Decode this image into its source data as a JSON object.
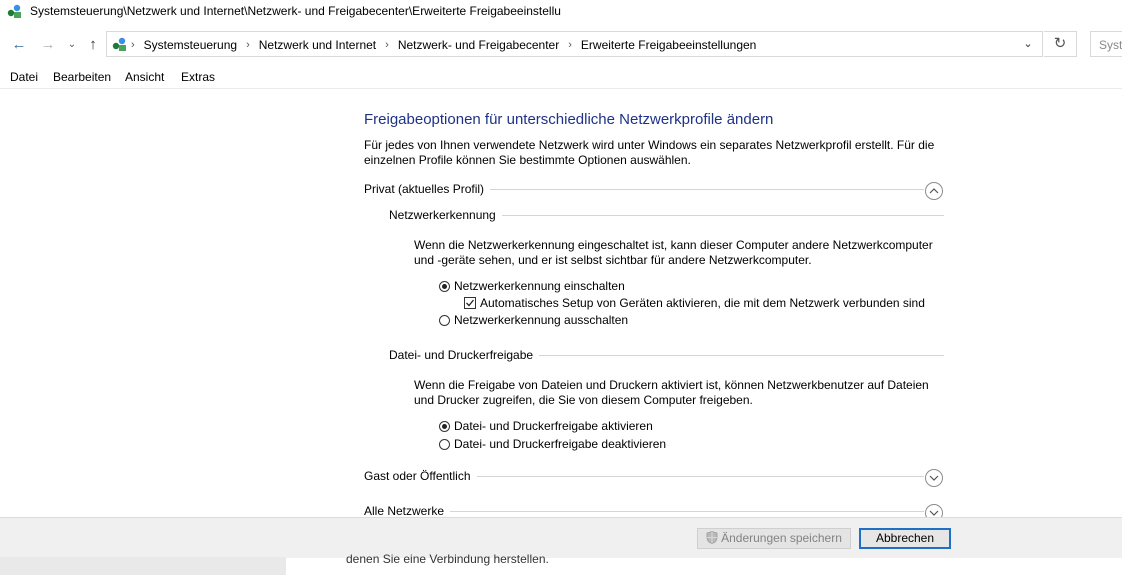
{
  "window": {
    "title": "Systemsteuerung\\Netzwerk und Internet\\Netzwerk- und Freigabecenter\\Erweiterte Freigabeeinstellu"
  },
  "address": {
    "crumbs": [
      "Systemsteuerung",
      "Netzwerk und Internet",
      "Netzwerk- und Freigabecenter",
      "Erweiterte Freigabeeinstellungen"
    ],
    "search_placeholder": "Syste"
  },
  "menu": {
    "file": "Datei",
    "edit": "Bearbeiten",
    "view": "Ansicht",
    "extras": "Extras"
  },
  "content": {
    "heading": "Freigabeoptionen für unterschiedliche Netzwerkprofile ändern",
    "intro_line1": "Für jedes von Ihnen verwendete Netzwerk wird unter Windows ein separates Netzwerkprofil erstellt. Für die",
    "intro_line2": "einzelnen Profile können Sie bestimmte Optionen auswählen.",
    "private_profile": "Privat (aktuelles Profil)",
    "discovery": {
      "title": "Netzwerkerkennung",
      "desc_line1": "Wenn die Netzwerkerkennung eingeschaltet ist, kann dieser Computer andere Netzwerkcomputer",
      "desc_line2": "und -geräte sehen, und er ist selbst sichtbar für andere Netzwerkcomputer.",
      "on": "Netzwerkerkennung einschalten",
      "auto_setup": "Automatisches Setup von Geräten aktivieren, die mit dem Netzwerk verbunden sind",
      "off": "Netzwerkerkennung ausschalten"
    },
    "sharing": {
      "title": "Datei- und Druckerfreigabe",
      "desc_line1": "Wenn die Freigabe von Dateien und Druckern aktiviert ist, können Netzwerkbenutzer auf Dateien",
      "desc_line2": "und Drucker zugreifen, die Sie von diesem Computer freigeben.",
      "on": "Datei- und Druckerfreigabe aktivieren",
      "off": "Datei- und Druckerfreigabe deaktivieren"
    },
    "guest_profile": "Gast oder Öffentlich",
    "all_networks": "Alle Netzwerke"
  },
  "buttons": {
    "save": "Änderungen speichern",
    "cancel": "Abbrechen"
  },
  "background": {
    "text": "denen Sie eine Verbindung herstellen."
  }
}
